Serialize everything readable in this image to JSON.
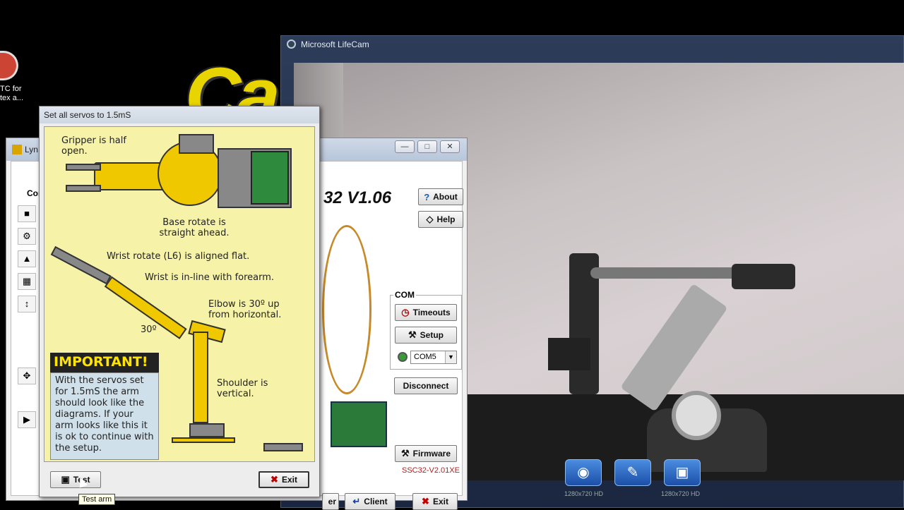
{
  "desktop": {
    "logo_text": "Ca",
    "icon_label_line1": "TC for",
    "icon_label_line2": "tex a..."
  },
  "lifecam": {
    "title": "Microsoft LifeCam",
    "buttons": [
      {
        "icon": "camera-icon",
        "caption": "1280x720 HD"
      },
      {
        "icon": "microphone-icon",
        "caption": ""
      },
      {
        "icon": "video-camera-icon",
        "caption": "1280x720 HD"
      }
    ]
  },
  "lynx": {
    "title": "Lyn",
    "section_label": "Con",
    "version": "32 V1.06",
    "about_label": "About",
    "help_label": "Help",
    "com_label": "COM",
    "timeouts_label": "Timeouts",
    "setup_label": "Setup",
    "com_port": "COM5",
    "disconnect_label": "Disconnect",
    "firmware_label": "Firmware",
    "firmware_version": "SSC32-V2.01XE",
    "server_label": "er",
    "client_label": "Client",
    "exit_label": "Exit"
  },
  "dialog": {
    "title": "Set all servos to 1.5mS",
    "gripper_text": "Gripper is half open.",
    "base_text": "Base rotate is straight ahead.",
    "wrist_rotate_text": "Wrist rotate (L6) is aligned flat.",
    "wrist_text": "Wrist is in-line with forearm.",
    "elbow_text": "Elbow is 30º up from horizontal.",
    "angle_text": "30º",
    "shoulder_text": "Shoulder is vertical.",
    "important_heading": "IMPORTANT!",
    "important_body": "With the servos set for 1.5mS the arm should look like the diagrams. If your arm looks like this it is ok to continue with the setup.",
    "test_label": "Test",
    "exit_label": "Exit",
    "tooltip": "Test arm"
  },
  "colors": {
    "panel_yellow": "#f6f3a8",
    "arm_yellow": "#f0c800",
    "important_text": "#ffe400",
    "exit_red": "#c00000"
  }
}
